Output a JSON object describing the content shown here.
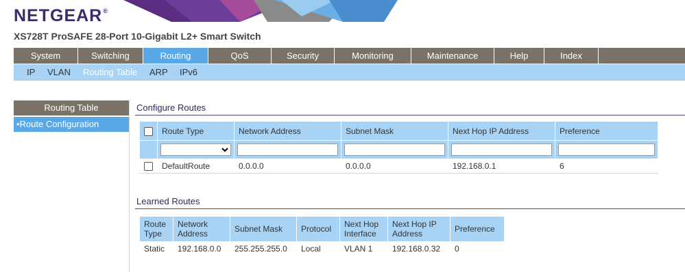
{
  "brand": {
    "logo": "NETGEAR",
    "trademark": "®",
    "product": "XS728T ProSAFE 28-Port 10-Gigabit L2+ Smart Switch"
  },
  "mainnav": [
    {
      "label": "System"
    },
    {
      "label": "Switching"
    },
    {
      "label": "Routing",
      "active": true
    },
    {
      "label": "QoS"
    },
    {
      "label": "Security"
    },
    {
      "label": "Monitoring"
    },
    {
      "label": "Maintenance"
    },
    {
      "label": "Help"
    },
    {
      "label": "Index"
    }
  ],
  "subnav": [
    {
      "label": "IP"
    },
    {
      "label": "VLAN"
    },
    {
      "label": "Routing Table",
      "active": true
    },
    {
      "label": "ARP"
    },
    {
      "label": "IPv6"
    }
  ],
  "leftpanel": {
    "title": "Routing Table",
    "item": "Route Configuration",
    "bullet": "•"
  },
  "configure": {
    "title": "Configure Routes",
    "headers": [
      "Route Type",
      "Network Address",
      "Subnet Mask",
      "Next Hop IP Address",
      "Preference"
    ],
    "filter_select_value": "",
    "row": {
      "route_type": "DefaultRoute",
      "network": "0.0.0.0",
      "subnet": "0.0.0.0",
      "next_hop": "192.168.0.1",
      "preference": "6"
    }
  },
  "learned": {
    "title": "Learned Routes",
    "headers": [
      "Route Type",
      "Network Address",
      "Subnet Mask",
      "Protocol",
      "Next Hop Interface",
      "Next Hop IP Address",
      "Preference"
    ],
    "row": {
      "route_type": "Static",
      "network": "192.168.0.0",
      "subnet": "255.255.255.0",
      "protocol": "Local",
      "interface": "VLAN 1",
      "next_hop": "192.168.0.32",
      "preference": "0"
    }
  },
  "colors": {
    "nav": "#7a7268",
    "active": "#5aa8e6",
    "subnav": "#a9d3f4",
    "brand": "#3b2b6b"
  }
}
